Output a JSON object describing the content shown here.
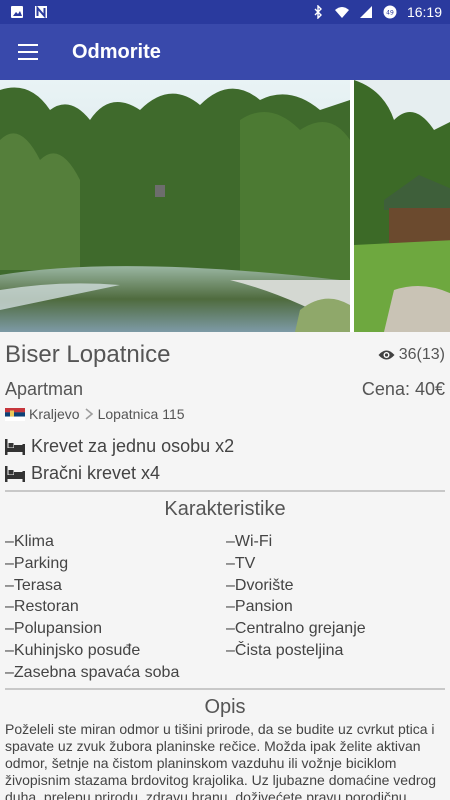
{
  "status_bar": {
    "time": "16:19",
    "battery_level": "49"
  },
  "app_bar": {
    "title": "Odmorite"
  },
  "listing": {
    "name": "Biser Lopatnice",
    "views": "36(13)",
    "type": "Apartman",
    "price": "Cena: 40€",
    "city": "Kraljevo",
    "address": "Lopatnica 115",
    "beds": [
      "Krevet za jednu osobu x2",
      "Bračni krevet x4"
    ]
  },
  "features_section": {
    "title": "Karakteristike",
    "items": [
      "–Klima",
      "–Wi-Fi",
      "–Parking",
      "–TV",
      "–Terasa",
      "–Dvorište",
      "–Restoran",
      "–Pansion",
      "–Polupansion",
      "–Centralno grejanje",
      "–Kuhinjsko posuđe",
      "–Čista posteljina",
      "–Zasebna spavaća soba",
      ""
    ]
  },
  "description_section": {
    "title": "Opis",
    "text": "Poželeli ste miran odmor u tišini prirode, da se budite uz cvrkut ptica i spavate uz zvuk žubora planinske rečice. Možda ipak želite aktivan odmor, šetnje na čistom planinskom vazduhu ili vožnje biciklom živopisnim stazama brdovitog krajolika. Uz ljubazne domaćine vedrog duha, prelepu prirodu, zdravu hranu, doživećete pravu porodičnu"
  },
  "colors": {
    "status_bar": "#2a3a9e",
    "app_bar": "#3949ab",
    "background": "#f5f5f5"
  },
  "icons": [
    "image-icon",
    "n-icon",
    "bluetooth-icon",
    "wifi-icon",
    "signal-icon",
    "battery-icon",
    "menu-icon",
    "eye-icon",
    "serbia-flag-icon",
    "chevron-right-icon",
    "bed-icon"
  ]
}
